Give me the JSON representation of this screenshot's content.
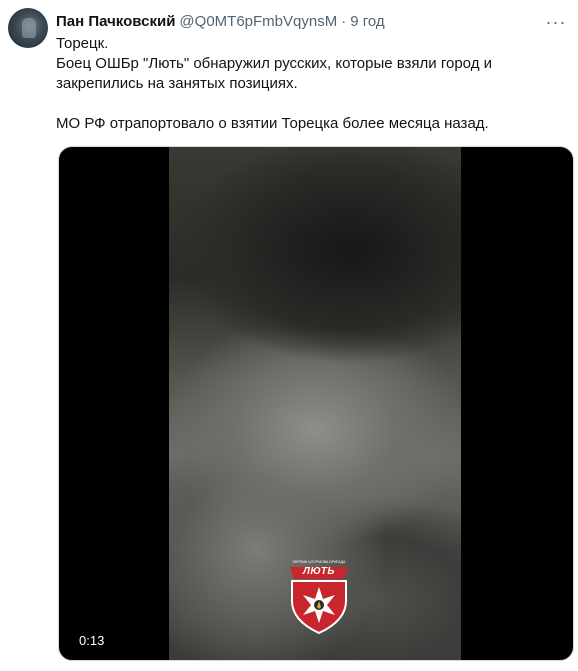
{
  "tweet": {
    "display_name": "Пан Пачковский",
    "handle": "@Q0MT6pFmbVqynsM",
    "separator": "·",
    "time": "9 год",
    "text_lines": [
      "Торецк.",
      "Боец ОШБр \"Лють\" обнаружил русских, которые взяли город и",
      "закрепились на занятых позициях.",
      "",
      "МО РФ отрапортовало о взятии Торецка более месяца назад."
    ],
    "more_icon": "ellipsis-icon"
  },
  "video": {
    "elapsed": "0:13",
    "watermark_text": "ЛЮТЬ",
    "colors": {
      "emblem_red": "#c8262c",
      "emblem_white": "#ffffff"
    }
  }
}
